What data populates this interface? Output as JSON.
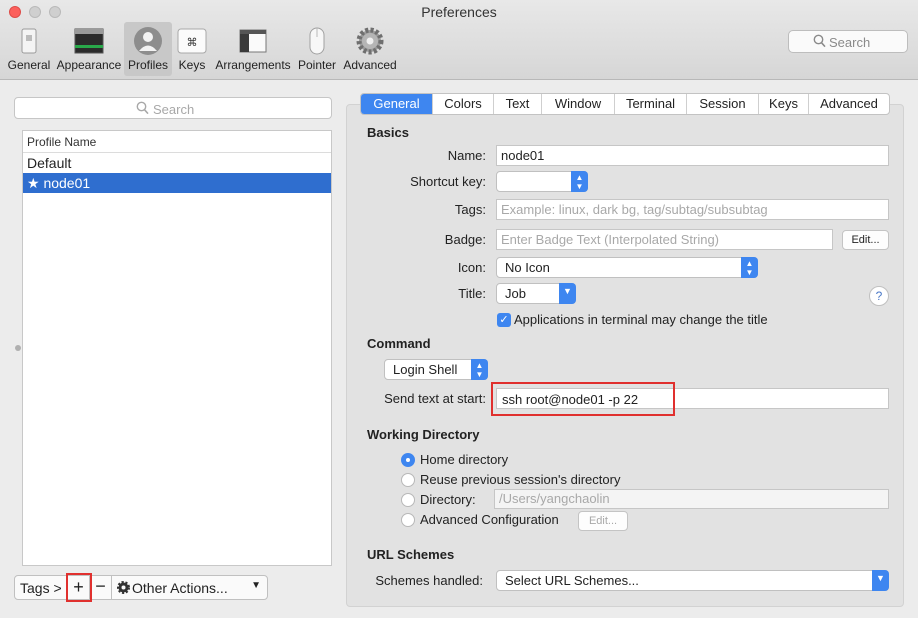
{
  "window": {
    "title": "Preferences"
  },
  "toolbar": {
    "items": [
      {
        "label": "General",
        "icon": "general-switch-icon"
      },
      {
        "label": "Appearance",
        "icon": "appearance-window-icon"
      },
      {
        "label": "Profiles",
        "icon": "profiles-person-icon",
        "active": true
      },
      {
        "label": "Keys",
        "icon": "keys-command-icon"
      },
      {
        "label": "Arrangements",
        "icon": "arrangements-windows-icon"
      },
      {
        "label": "Pointer",
        "icon": "pointer-mouse-icon"
      },
      {
        "label": "Advanced",
        "icon": "advanced-gear-icon"
      }
    ],
    "search_placeholder": "Search"
  },
  "profiles": {
    "search_placeholder": "Search",
    "column_header": "Profile Name",
    "rows": [
      {
        "name": "Default",
        "selected": false
      },
      {
        "name": "★ node01",
        "selected": true
      }
    ],
    "tags_label": "Tags >",
    "add_label": "+",
    "remove_label": "−",
    "other_actions_label": "Other Actions..."
  },
  "tabs": [
    "General",
    "Colors",
    "Text",
    "Window",
    "Terminal",
    "Session",
    "Keys",
    "Advanced"
  ],
  "basics": {
    "heading": "Basics",
    "name_label": "Name:",
    "name_value": "node01",
    "shortcut_label": "Shortcut key:",
    "shortcut_value": "",
    "tags_label": "Tags:",
    "tags_placeholder": "Example: linux, dark bg, tag/subtag/subsubtag",
    "badge_label": "Badge:",
    "badge_placeholder": "Enter Badge Text (Interpolated String)",
    "badge_edit": "Edit...",
    "icon_label": "Icon:",
    "icon_value": "No Icon",
    "title_label": "Title:",
    "title_value": "Job",
    "help": "?",
    "apps_change_title": "Applications in terminal may change the title",
    "apps_change_title_checked": true
  },
  "command": {
    "heading": "Command",
    "type_value": "Login Shell",
    "send_text_label": "Send text at start:",
    "send_text_value": "ssh root@node01 -p 22"
  },
  "working_directory": {
    "heading": "Working Directory",
    "options": [
      {
        "label": "Home directory",
        "selected": true
      },
      {
        "label": "Reuse previous session's directory",
        "selected": false
      },
      {
        "label": "Directory:",
        "selected": false
      },
      {
        "label": "Advanced Configuration",
        "selected": false
      }
    ],
    "directory_placeholder": "/Users/yangchaolin",
    "edit_label": "Edit..."
  },
  "url_schemes": {
    "heading": "URL Schemes",
    "label": "Schemes handled:",
    "value": "Select URL Schemes..."
  },
  "colors": {
    "accent": "#3e86f0",
    "selection": "#2f6ecf",
    "highlight": "#e0302e"
  }
}
